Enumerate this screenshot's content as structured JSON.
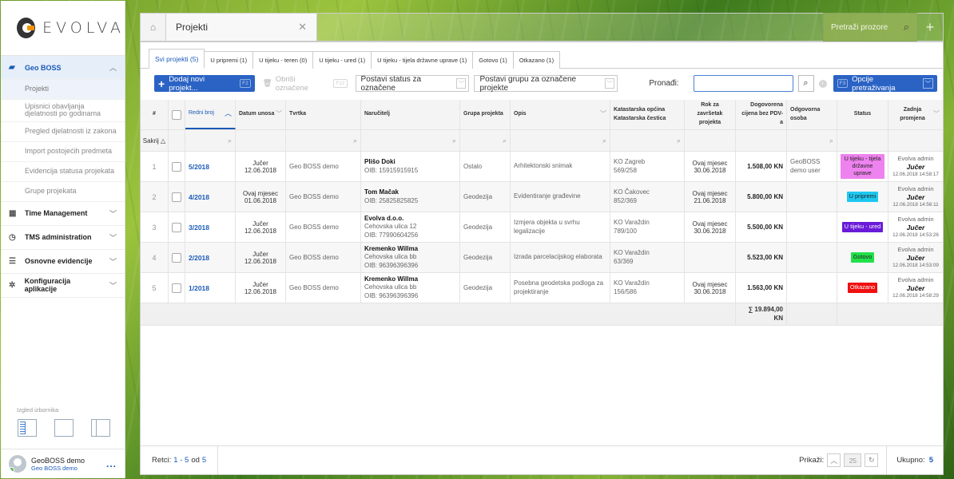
{
  "brand": {
    "name": "EVOLVA"
  },
  "sidebar": {
    "sections": [
      {
        "label": "Geo BOSS",
        "icon": "book-icon",
        "expanded": true
      },
      {
        "label": "Time Management",
        "icon": "calendar-icon"
      },
      {
        "label": "TMS administration",
        "icon": "clock-icon"
      },
      {
        "label": "Osnovne evidencije",
        "icon": "list-icon"
      },
      {
        "label": "Konfiguracija aplikacije",
        "icon": "gear-icon"
      }
    ],
    "subitems": [
      "Projekti",
      "Upisnici obavljanja djelatnosti po godinama",
      "Pregled djelatnosti iz zakona",
      "Import postojećih predmeta",
      "Evidencija statusa projekata",
      "Grupe projekata"
    ],
    "layout_label": "Izgled izbornika",
    "user": {
      "name": "GeoBOSS demo",
      "org": "Geo BOSS demo",
      "more": "..."
    }
  },
  "window": {
    "tab_title": "Projekti",
    "close": "✕",
    "search_placeholder": "Pretraži prozore",
    "add": "+"
  },
  "subtabs": [
    "Svi projekti (5)",
    "U pripremi (1)",
    "U tijeku - teren (0)",
    "U tijeku - ured (1)",
    "U tijeku - tijela državne uprave (1)",
    "Gotovo (1)",
    "Otkazano (1)"
  ],
  "toolbar": {
    "add_label": "Dodaj novi projekt...",
    "add_key": "F2",
    "delete_label": "Obriši označene",
    "delete_key": "F12",
    "status_select": "Postavi status za označene",
    "group_select": "Postavi grupu za označene projekte",
    "find_label": "Pronađi:",
    "find_value": "",
    "options_label": "Opcije pretraživanja",
    "options_key": "F3"
  },
  "table": {
    "headers": {
      "num": "#",
      "ref": "Redni broj",
      "date": "Datum unosa",
      "firm": "Tvrtka",
      "client": "Naručitelj",
      "group": "Grupa projekta",
      "desc": "Opis",
      "cadastre": "Katastarska općina Katastarska čestica",
      "deadline": "Rok za završetak projekta",
      "price": "Dogovorena cijena bez PDV-a",
      "owner": "Odgovorna osoba",
      "status": "Status",
      "changed": "Zadnja promjena"
    },
    "filter_label": "Sakrij",
    "rows": [
      {
        "n": "1",
        "ref": "5/2018",
        "date1": "Jučer",
        "date2": "12.06.2018",
        "firm": "Geo BOSS demo",
        "client": "Plišo Doki",
        "client_addr": "",
        "client_oib": "OIB: 15915915915",
        "group": "Ostalo",
        "desc": "Arhitektonski snimak",
        "ko": "KO Zagreb",
        "kc": "569/258",
        "dl1": "Ovaj mjesec",
        "dl2": "30.06.2018",
        "price": "1.508,00 KN",
        "owner": "GeoBOSS demo user",
        "status": "U tijeku - tijela državne uprave",
        "status_color": "#ee82ee",
        "status_text": "#222222",
        "ch_user": "Evolva admin",
        "ch_day": "Jučer",
        "ch_ts": "12.06.2018 14:58:17"
      },
      {
        "n": "2",
        "ref": "4/2018",
        "date1": "Ovaj mjesec",
        "date2": "01.06.2018",
        "firm": "Geo BOSS demo",
        "client": "Tom Mačak",
        "client_addr": "",
        "client_oib": "OIB: 25825825825",
        "group": "Geodezija",
        "desc": "Evidentiranje građevine",
        "ko": "KO Čakovec",
        "kc": "852/369",
        "dl1": "Ovaj mjesec",
        "dl2": "21.06.2018",
        "price": "5.800,00 KN",
        "owner": "",
        "status": "U pripremi",
        "status_color": "#1ec8f0",
        "status_text": "#222222",
        "ch_user": "Evolva admin",
        "ch_day": "Jučer",
        "ch_ts": "12.06.2018 14:56:11"
      },
      {
        "n": "3",
        "ref": "3/2018",
        "date1": "Jučer",
        "date2": "12.06.2018",
        "firm": "Geo BOSS demo",
        "client": "Evolva d.o.o.",
        "client_addr": "Cehovska ulica 12",
        "client_oib": "OIB: 77990604256",
        "group": "Geodezija",
        "desc": "Izmjera objekta u svrhu legalizacije",
        "ko": "KO Varaždin",
        "kc": "789/100",
        "dl1": "Ovaj mjesec",
        "dl2": "30.06.2018",
        "price": "5.500,00 KN",
        "owner": "",
        "status": "U tijeku - ured",
        "status_color": "#6a1bd8",
        "status_text": "#ffffff",
        "ch_user": "Evolva admin",
        "ch_day": "Jučer",
        "ch_ts": "12.06.2018 14:53:26"
      },
      {
        "n": "4",
        "ref": "2/2018",
        "date1": "Jučer",
        "date2": "12.06.2018",
        "firm": "Geo BOSS demo",
        "client": "Kremenko Willma",
        "client_addr": "Cehovska ulica bb",
        "client_oib": "OIB: 96396396396",
        "group": "Geodezija",
        "desc": "Izrada parcelacijskog elaborata",
        "ko": "KO Varaždin",
        "kc": "63/369",
        "dl1": "",
        "dl2": "",
        "price": "5.523,00 KN",
        "owner": "",
        "status": "Gotovo",
        "status_color": "#22e04a",
        "status_text": "#222222",
        "ch_user": "Evolva admin",
        "ch_day": "Jučer",
        "ch_ts": "12.06.2018 14:53:09"
      },
      {
        "n": "5",
        "ref": "1/2018",
        "date1": "Jučer",
        "date2": "12.06.2018",
        "firm": "Geo BOSS demo",
        "client": "Kremenko Willma",
        "client_addr": "Cehovska ulica bb",
        "client_oib": "OIB: 96396396396",
        "group": "Geodezija",
        "desc": "Posebna geodetska podloga za projektiranje",
        "ko": "KO Varaždin",
        "kc": "156/586",
        "dl1": "Ovaj mjesec",
        "dl2": "30.06.2018",
        "price": "1.563,00 KN",
        "owner": "",
        "status": "Otkazano",
        "status_color": "#f01010",
        "status_text": "#ffffff",
        "ch_user": "Evolva admin",
        "ch_day": "Jučer",
        "ch_ts": "12.06.2018 14:58:29"
      }
    ],
    "sum": "∑ 19.894,00 KN"
  },
  "footer": {
    "rows_label": "Retci:",
    "rows_range": "1 - 5",
    "rows_of": "od",
    "rows_total": "5",
    "show_label": "Prikaži:",
    "page_size": "25",
    "total_label": "Ukupno:",
    "total": "5"
  }
}
